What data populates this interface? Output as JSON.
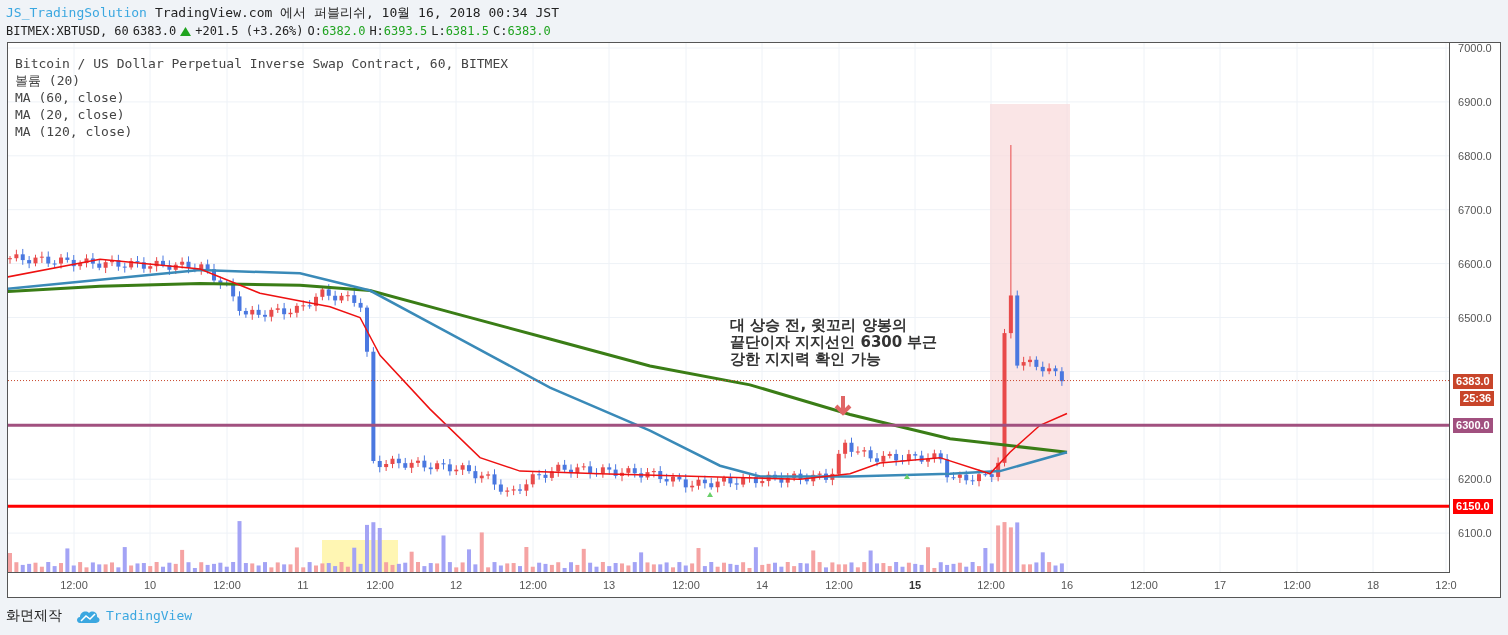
{
  "header": {
    "author": "JS_TradingSolution",
    "published": "TradingView.com 에서 퍼블리쉬, 10월 16, 2018 00:34 JST"
  },
  "quote": {
    "symbol": "BITMEX:XBTUSD, 60",
    "last": "6383.0",
    "change": "+201.5 (+3.26%)",
    "rising": true,
    "ohlc": [
      {
        "label": "O:",
        "value": "6382.0"
      },
      {
        "label": "H:",
        "value": "6393.5"
      },
      {
        "label": "L:",
        "value": "6381.5"
      },
      {
        "label": "C:",
        "value": "6383.0"
      }
    ]
  },
  "legend": [
    "Bitcoin / US Dollar Perpetual Inverse Swap Contract, 60, BITMEX",
    "볼륨 (20)",
    "MA (60, close)",
    "MA (20, close)",
    "MA (120, close)"
  ],
  "annotation": "대 상승 전, 윗꼬리 양봉의\n끝단이자 지지선인 **6300** 부근\n강한 지지력 확인 가능",
  "price_axis": [
    "7000.0",
    "6900.0",
    "6800.0",
    "6700.0",
    "6600.0",
    "6500.0",
    "6200.0",
    "6100.0"
  ],
  "price_tags": [
    {
      "text": "6383.0",
      "color": "#c8452a"
    },
    {
      "text": "25:36",
      "color": "#c8452a"
    },
    {
      "text": "6300.0",
      "color": "#a1507f"
    },
    {
      "text": "6150.0",
      "color": "#ff0000"
    }
  ],
  "time_axis": [
    {
      "text": "12:00",
      "emphasized": false
    },
    {
      "text": "10",
      "emphasized": false
    },
    {
      "text": "12:00",
      "emphasized": false
    },
    {
      "text": "11",
      "emphasized": false
    },
    {
      "text": "12:00",
      "emphasized": false
    },
    {
      "text": "12",
      "emphasized": false
    },
    {
      "text": "12:00",
      "emphasized": false
    },
    {
      "text": "13",
      "emphasized": false
    },
    {
      "text": "12:00",
      "emphasized": false
    },
    {
      "text": "14",
      "emphasized": false
    },
    {
      "text": "12:00",
      "emphasized": false
    },
    {
      "text": "15",
      "emphasized": true
    },
    {
      "text": "12:00",
      "emphasized": false
    },
    {
      "text": "16",
      "emphasized": false
    },
    {
      "text": "12:00",
      "emphasized": false
    },
    {
      "text": "17",
      "emphasized": false
    },
    {
      "text": "12:00",
      "emphasized": false
    },
    {
      "text": "18",
      "emphasized": false
    },
    {
      "text": "12:0",
      "emphasized": false
    }
  ],
  "footer": {
    "label": "화면제작",
    "brand": "TradingView"
  }
}
